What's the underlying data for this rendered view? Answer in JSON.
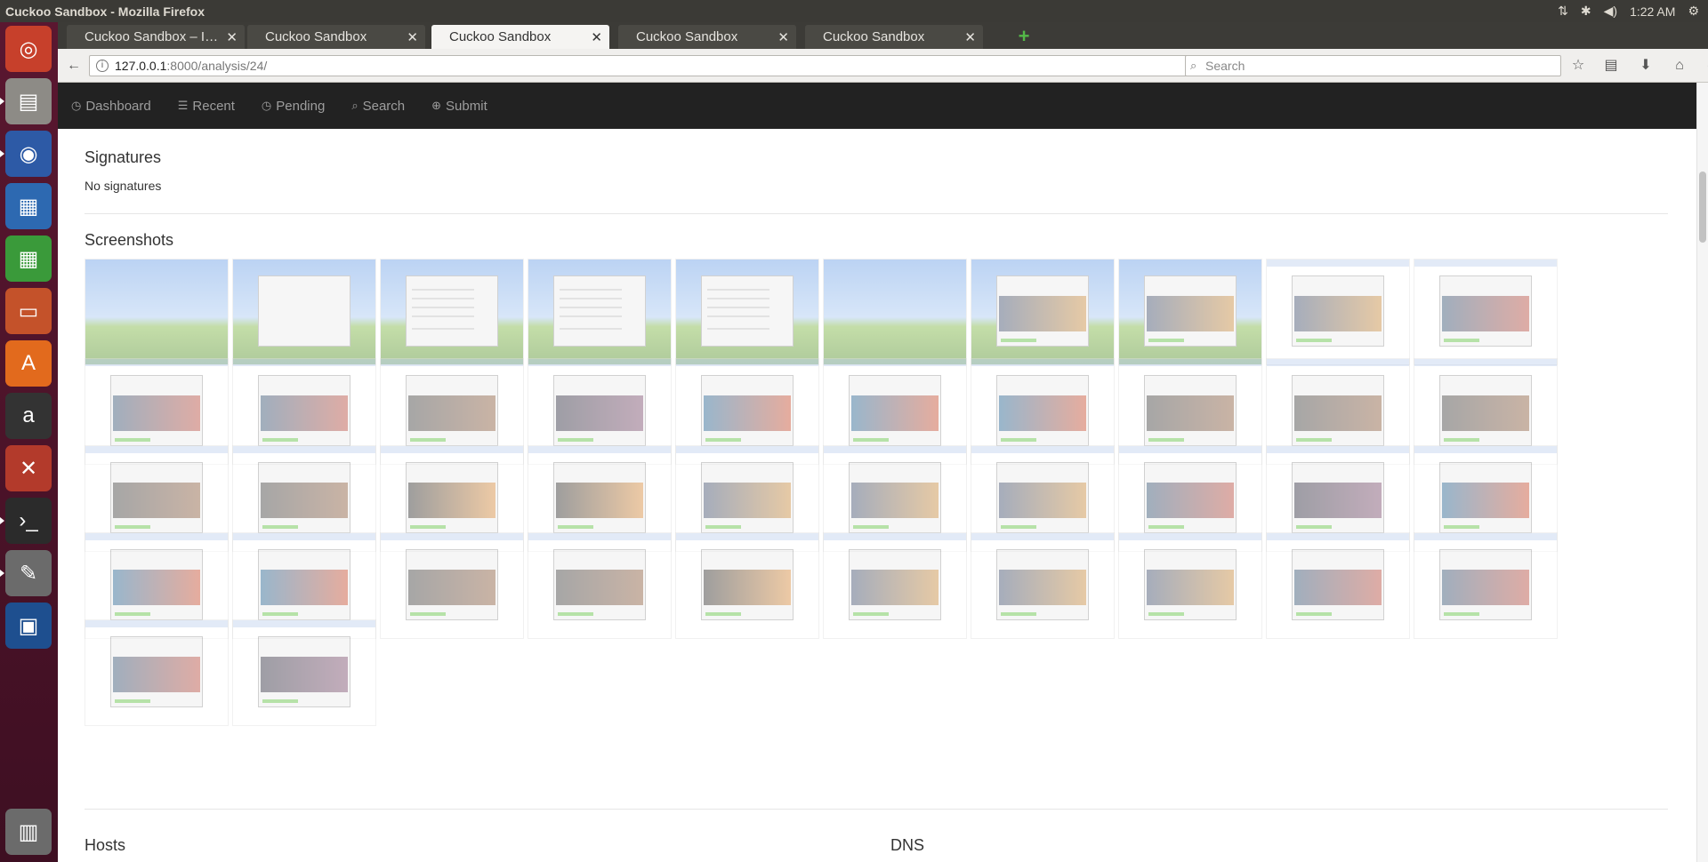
{
  "window": {
    "title": "Cuckoo Sandbox - Mozilla Firefox",
    "clock": "1:22 AM"
  },
  "tabs": [
    {
      "label": "Cuckoo Sandbox – I…",
      "active": false
    },
    {
      "label": "Cuckoo Sandbox",
      "active": false
    },
    {
      "label": "Cuckoo Sandbox",
      "active": true
    },
    {
      "label": "Cuckoo Sandbox",
      "active": false
    },
    {
      "label": "Cuckoo Sandbox",
      "active": false
    }
  ],
  "url": {
    "host": "127.0.0.1",
    "rest": ":8000/analysis/24/"
  },
  "search": {
    "placeholder": "Search"
  },
  "nav": {
    "dashboard": "Dashboard",
    "recent": "Recent",
    "pending": "Pending",
    "search": "Search",
    "submit": "Submit"
  },
  "sections": {
    "signatures_title": "Signatures",
    "signatures_text": "No signatures",
    "screenshots_title": "Screenshots",
    "hosts_title": "Hosts",
    "dns_title": "DNS"
  },
  "screenshots": {
    "rows": [
      [
        "xp-desktop",
        "xp-blank-window",
        "xp-installer",
        "xp-installer",
        "xp-installer",
        "xp-desktop",
        "xp-media-grabber",
        "xp-media-grabber",
        "media-grabber",
        "torch-facelift"
      ],
      [
        "torch-facelift",
        "torch-facelift",
        "torch-torrent",
        "torch-music",
        "torch-games",
        "torch-games",
        "torch-games",
        "torch-torrent",
        "torch-torrent",
        "torch-torrent"
      ],
      [
        "torch-torrent",
        "torch-torrent",
        "torch-player",
        "torch-player",
        "media-grabber",
        "media-grabber",
        "media-grabber",
        "torch-facelift",
        "torch-music",
        "torch-games"
      ],
      [
        "torch-games",
        "torch-games",
        "torch-torrent",
        "torch-torrent",
        "torch-player",
        "media-grabber",
        "media-grabber",
        "media-grabber",
        "torch-facelift",
        "torch-facelift"
      ],
      [
        "torch-facelift",
        "torch-music"
      ]
    ]
  },
  "colors": {
    "navbar": "#222222",
    "nav_text": "#9d9d9d",
    "launcher": "#5a1730",
    "accent_green": "#54b948"
  }
}
